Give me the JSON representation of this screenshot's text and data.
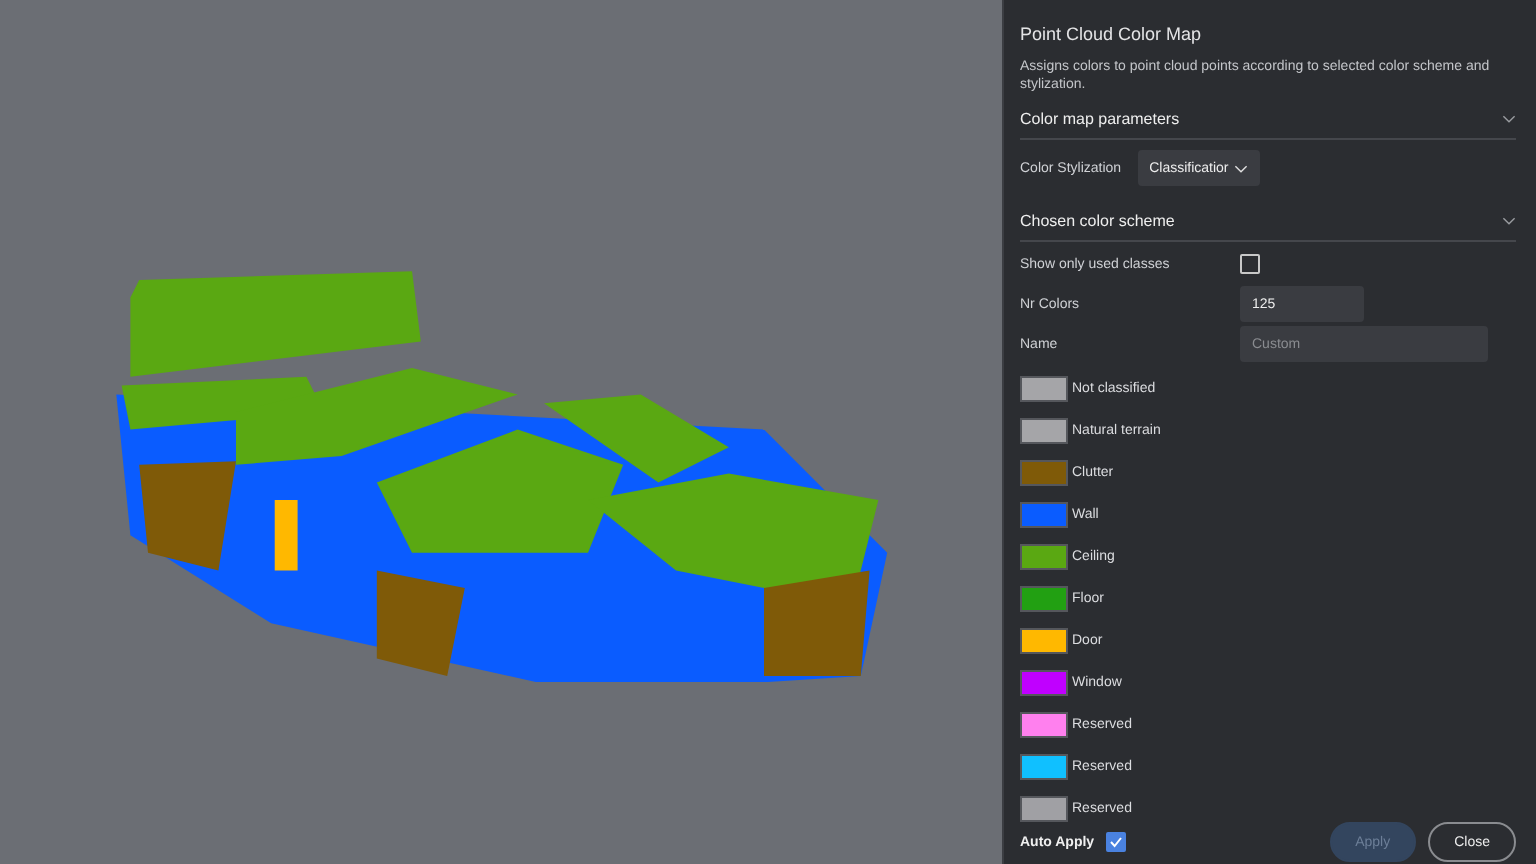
{
  "panel": {
    "title": "Point Cloud Color Map",
    "description": "Assigns colors to point cloud points according to selected color scheme and stylization.",
    "color_map_parameters": {
      "heading": "Color map parameters",
      "expanded": true,
      "stylization_label": "Color Stylization",
      "stylization_value": "Classificatior"
    },
    "color_scheme": {
      "heading": "Chosen color scheme",
      "expanded": true,
      "show_only_used_label": "Show only used classes",
      "show_only_used_checked": false,
      "nr_colors_label": "Nr Colors",
      "nr_colors_value": "125",
      "name_label": "Name",
      "name_placeholder": "Custom",
      "classes": [
        {
          "label": "Not classified",
          "color": "#a5a5a8"
        },
        {
          "label": "Natural terrain",
          "color": "#a5a5a8"
        },
        {
          "label": "Clutter",
          "color": "#7f5a08"
        },
        {
          "label": "Wall",
          "color": "#0a5cff"
        },
        {
          "label": "Ceiling",
          "color": "#5aa812"
        },
        {
          "label": "Floor",
          "color": "#22a012"
        },
        {
          "label": "Door",
          "color": "#ffb800"
        },
        {
          "label": "Window",
          "color": "#c000ff"
        },
        {
          "label": "Reserved",
          "color": "#ff80ee"
        },
        {
          "label": "Reserved",
          "color": "#10c0ff"
        },
        {
          "label": "Reserved",
          "color": "#a0a0a4"
        }
      ]
    },
    "auto_apply": {
      "label": "Auto Apply",
      "checked": true
    },
    "buttons": [
      {
        "label": "Apply",
        "disabled": true
      },
      {
        "label": "Close",
        "disabled": false
      }
    ]
  }
}
